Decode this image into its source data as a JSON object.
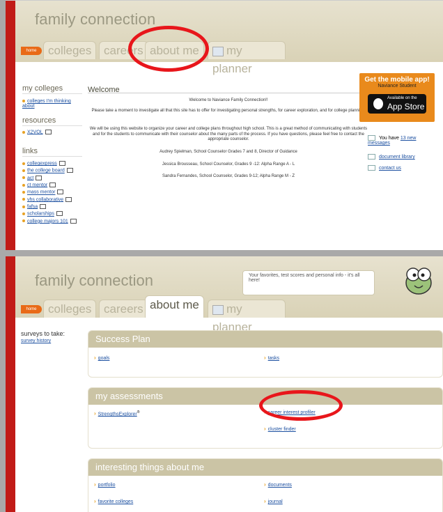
{
  "colors": {
    "brand_red": "#c11b17",
    "accent_orange": "#e96a17",
    "header_tan": "#d9d2b6",
    "link_blue": "#1b4fa0"
  },
  "top": {
    "logo": "family connection",
    "home_tab": "home",
    "tabs": [
      "colleges",
      "careers",
      "about me",
      "my planner"
    ],
    "my_colleges_heading": "my colleges",
    "colleges_thinking_link": "colleges I'm thinking about",
    "resources_heading": "resources",
    "x2vol_link": "X2VOL",
    "links_heading": "links",
    "links": [
      "collegexpress",
      "the college board",
      "act",
      "ct mentor",
      "mass mentor",
      "vhs collaborative",
      "fafsa",
      "scholarships",
      "college majors 101"
    ],
    "welcome_title": "Welcome",
    "welcome_lines": [
      "Welcome to Naviance Family Connection!!",
      "Please take a moment to investigate all that this site has to offer for investigating personal strengths, for career exploration, and for college planning.",
      "We will be using this website to organize your career and college plans throughout high school. This is a great method of communicating with students and for the students to communicate with their counselor about the many parts of the process. If you have questions, please feel free to contact the appropriate counselor.",
      "Audrey Spielman, School Counselor Grades 7 and 8, Director of Guidance",
      "Jessica Brousseau, School Counselor, Grades 9 -12:  Alpha Range A - L",
      "Sandra Fernandes, School Counselor, Grades 9-12;  Alpha Range  M - Z"
    ],
    "app_badge": {
      "title": "Get the mobile app!",
      "subtitle": "Naviance Student",
      "store_small": "Available on the",
      "store_big": "App Store"
    },
    "messages_prefix": "You have ",
    "messages_link": "13 new messages",
    "document_library": "document library",
    "contact_us": "contact us"
  },
  "bottom": {
    "logo": "family connection",
    "bubble_text": "Your favorites, test scores and personal info - it's all here!",
    "home_tab": "home",
    "tabs": [
      "colleges",
      "careers",
      "about me",
      "my planner"
    ],
    "surveys_label": "surveys to take:",
    "survey_history": "survey history",
    "success_plan": {
      "title": "Success Plan",
      "items": [
        "goals",
        "tasks"
      ]
    },
    "assessments": {
      "title": "my assessments",
      "items": [
        "StrengthsExplorer",
        "career interest profiler",
        "cluster finder"
      ],
      "reg": "®"
    },
    "interesting": {
      "title": "interesting things about me",
      "items": [
        "portfolio",
        "documents",
        "favorite colleges",
        "journal"
      ]
    }
  }
}
